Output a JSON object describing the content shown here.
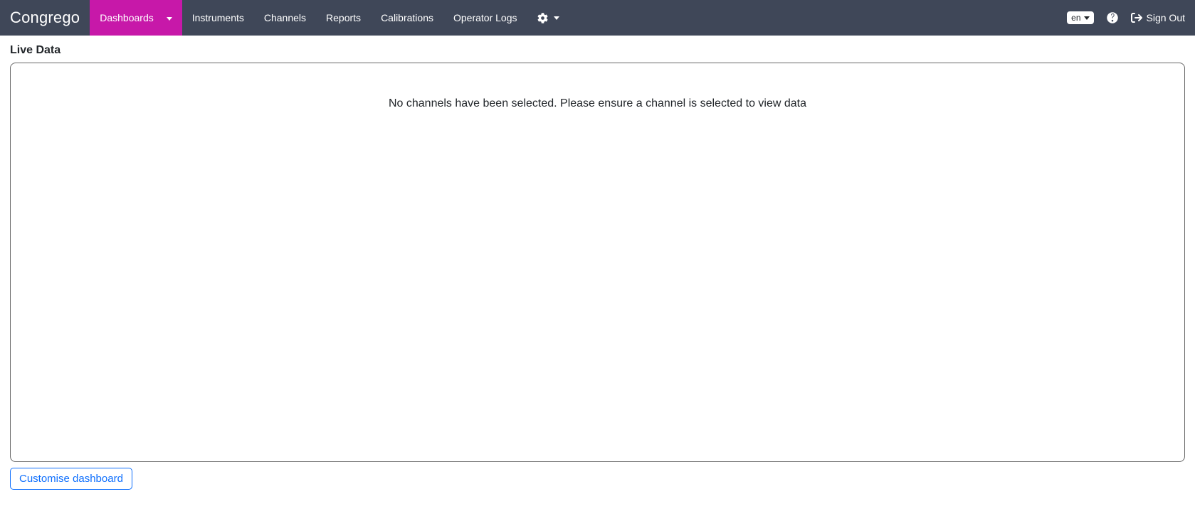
{
  "brand": "Congrego",
  "nav": {
    "dashboards": "Dashboards",
    "instruments": "Instruments",
    "channels": "Channels",
    "reports": "Reports",
    "calibrations": "Calibrations",
    "operator_logs": "Operator Logs"
  },
  "right": {
    "lang": "en",
    "signout": "Sign Out"
  },
  "page": {
    "title": "Live Data",
    "empty_message": "No channels have been selected. Please ensure a channel is selected to view data",
    "customise_button": "Customise dashboard"
  }
}
